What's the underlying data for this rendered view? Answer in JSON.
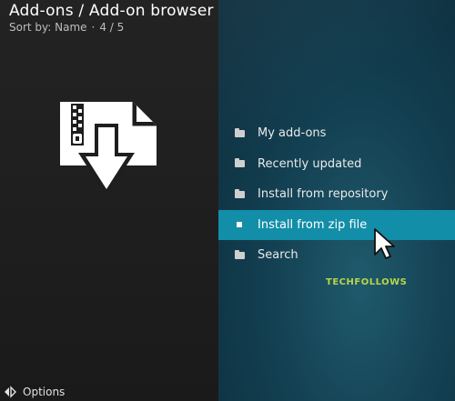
{
  "header": {
    "title": "Add-ons / Add-on browser",
    "sort_label": "Sort by: Name",
    "separator": "·",
    "position": "4 / 5"
  },
  "menu": {
    "items": [
      {
        "label": "My add-ons",
        "icon": "folder-icon"
      },
      {
        "label": "Recently updated",
        "icon": "folder-icon"
      },
      {
        "label": "Install from repository",
        "icon": "folder-icon"
      },
      {
        "label": "Install from zip file",
        "icon": "bullet-icon",
        "selected": true
      },
      {
        "label": "Search",
        "icon": "folder-icon"
      }
    ]
  },
  "watermark": "TECHFOLLOWS",
  "footer": {
    "options_label": "Options"
  },
  "colors": {
    "selected_bg": "#138ea8",
    "right_pane_bg": "#134052",
    "left_pane_bg": "#1e1e1e",
    "watermark": "#b8d64a"
  }
}
